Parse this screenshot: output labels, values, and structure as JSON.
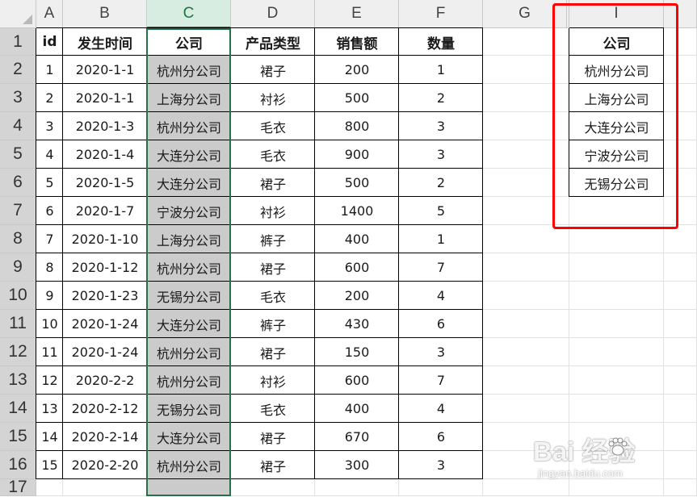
{
  "columns": [
    "A",
    "B",
    "C",
    "D",
    "E",
    "F",
    "G",
    "",
    "I"
  ],
  "rows": [
    "1",
    "2",
    "3",
    "4",
    "5",
    "6",
    "7",
    "8",
    "9",
    "10",
    "11",
    "12",
    "13",
    "14",
    "15",
    "16",
    "17"
  ],
  "main_table": {
    "headers": [
      "id",
      "发生时间",
      "公司",
      "产品类型",
      "销售额",
      "数量"
    ],
    "rows": [
      [
        "1",
        "2020-1-1",
        "杭州分公司",
        "裙子",
        "200",
        "1"
      ],
      [
        "2",
        "2020-1-1",
        "上海分公司",
        "衬衫",
        "500",
        "2"
      ],
      [
        "3",
        "2020-1-3",
        "杭州分公司",
        "毛衣",
        "800",
        "3"
      ],
      [
        "4",
        "2020-1-4",
        "大连分公司",
        "毛衣",
        "900",
        "3"
      ],
      [
        "5",
        "2020-1-5",
        "大连分公司",
        "裙子",
        "500",
        "2"
      ],
      [
        "6",
        "2020-1-7",
        "宁波分公司",
        "衬衫",
        "1400",
        "5"
      ],
      [
        "7",
        "2020-1-10",
        "上海分公司",
        "裤子",
        "400",
        "1"
      ],
      [
        "8",
        "2020-1-12",
        "杭州分公司",
        "裙子",
        "600",
        "7"
      ],
      [
        "9",
        "2020-1-23",
        "无锡分公司",
        "毛衣",
        "200",
        "4"
      ],
      [
        "10",
        "2020-1-24",
        "大连分公司",
        "裤子",
        "430",
        "6"
      ],
      [
        "11",
        "2020-1-24",
        "杭州分公司",
        "裙子",
        "150",
        "3"
      ],
      [
        "12",
        "2020-2-2",
        "杭州分公司",
        "衬衫",
        "600",
        "7"
      ],
      [
        "13",
        "2020-2-12",
        "无锡分公司",
        "毛衣",
        "400",
        "4"
      ],
      [
        "14",
        "2020-2-14",
        "大连分公司",
        "裙子",
        "670",
        "6"
      ],
      [
        "15",
        "2020-2-20",
        "杭州分公司",
        "裙子",
        "300",
        "3"
      ]
    ]
  },
  "side_table": {
    "header": "公司",
    "items": [
      "杭州分公司",
      "上海分公司",
      "大连分公司",
      "宁波分公司",
      "无锡分公司"
    ]
  },
  "watermark": {
    "brand": "Bai  经验",
    "sub": "jingyan.baidu.com"
  },
  "colors": {
    "selection_green": "#217346",
    "selected_column_fill": "#cbcbcb",
    "highlight_box": "#ff0000"
  }
}
